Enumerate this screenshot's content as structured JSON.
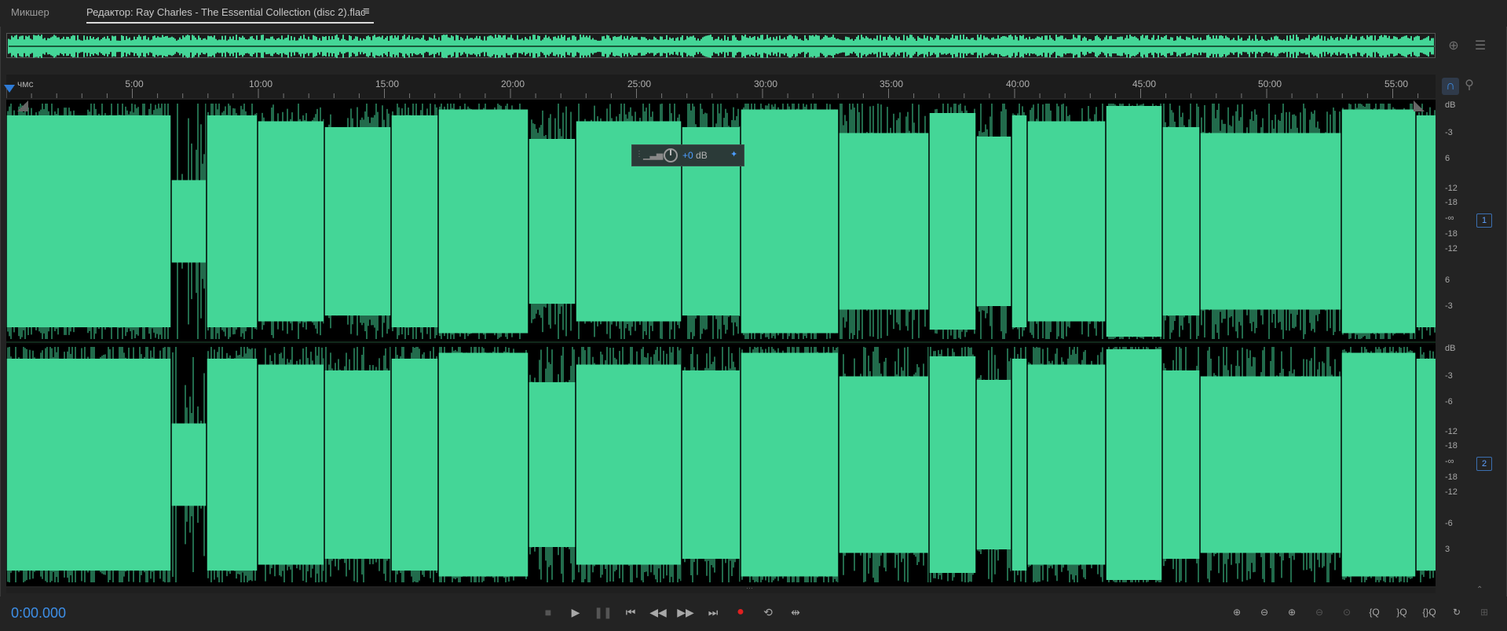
{
  "tabs": {
    "mixer": "Микшер",
    "editor": "Редактор: Ray Charles - The Essential Collection (disc 2).flac",
    "menu_icon": "hamburger-menu-icon"
  },
  "ruler": {
    "unit": "чмс",
    "labels": [
      "5:00",
      "10:00",
      "15:00",
      "20:00",
      "25:00",
      "30:00",
      "35:00",
      "40:00",
      "45:00",
      "50:00",
      "55:00"
    ]
  },
  "hud": {
    "value_num": "+0",
    "value_unit": "dB"
  },
  "db_scale": {
    "ch1": [
      "dB",
      "-3",
      "6",
      "-12",
      "-18",
      "-∞",
      "-18",
      "-12",
      "6",
      "-3"
    ],
    "ch2": [
      "dB",
      "-3",
      "-6",
      "-12",
      "-18",
      "-∞",
      "-18",
      "-12",
      "-6",
      "3"
    ]
  },
  "channels": [
    "1",
    "2"
  ],
  "transport": {
    "timecode": "0:00.000",
    "buttons": [
      "stop-icon",
      "play-icon",
      "pause-icon",
      "skip-to-start-icon",
      "rewind-icon",
      "fast-forward-icon",
      "skip-to-end-icon",
      "record-icon",
      "loop-icon",
      "skip-selection-icon"
    ]
  },
  "zoom_buttons": [
    "zoom-in-amplitude-icon",
    "zoom-out-amplitude-icon",
    "zoom-in-time-icon",
    "zoom-out-full-icon",
    "zoom-to-selection-icon",
    "zoom-in-point-in-icon",
    "zoom-in-point-out-icon",
    "zoom-out-both-icon",
    "zoom-reset-icon",
    "zoom-full-icon"
  ],
  "colors": {
    "waveform": "#44d697",
    "accent": "#3d8fe8",
    "background": "#232323"
  }
}
